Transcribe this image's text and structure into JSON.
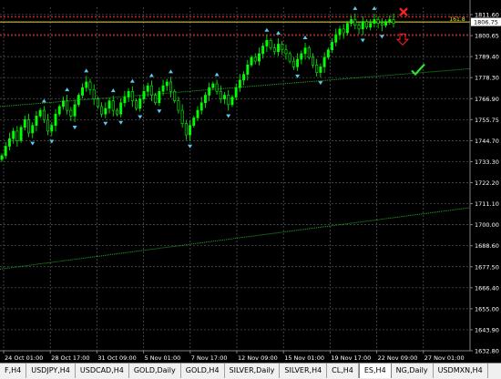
{
  "colors": {
    "background": "#000000",
    "grid": "#5a5a5a",
    "axis_text": "#ffffff",
    "bull": "#00ff00",
    "bear": "#00aa00",
    "wick": "#00ff00",
    "arrow": "#5cc8f0",
    "fib_line": "#e8e020",
    "resistance_line": "#ff2020",
    "trend_line": "#22aa22",
    "cross": "#ff2020",
    "down_arrow": "#ff2020",
    "check": "#30e030",
    "price_tag_bg": "#ffffff",
    "price_tag_text": "#000000"
  },
  "chart_data": {
    "type": "candlestick",
    "symbol": "ES,H4",
    "ylim": [
      1632.8,
      1814.5
    ],
    "price_ticks": [
      "1811.60",
      "1800.65",
      "1789.40",
      "1778.30",
      "1766.90",
      "1755.75",
      "1744.70",
      "1733.30",
      "1722.20",
      "1711.10",
      "1700.00",
      "1688.60",
      "1677.50",
      "1666.40",
      "1655.00",
      "1643.90",
      "1632.80"
    ],
    "time_labels": [
      "24 Oct 01:00",
      "28 Oct 17:00",
      "31 Oct 09:00",
      "5 Nov 01:00",
      "7 Nov 17:00",
      "12 Nov 09:00",
      "15 Nov 01:00",
      "19 Nov 17:00",
      "22 Nov 09:00",
      "27 Nov 01:00"
    ],
    "current_price_label": "1806.75",
    "fib_label": "161.8",
    "fib_level": 1806.75,
    "resistance_levels": [
      1809.5,
      1800.0
    ],
    "trend_lines": [
      {
        "x0": 0,
        "y0": 1762.0,
        "x1": 175,
        "y1": 1782.0
      },
      {
        "x0": 0,
        "y0": 1676.0,
        "x1": 175,
        "y1": 1708.5
      }
    ],
    "signals": {
      "cross_price": 1812.0,
      "down_arrow_price": 1797.5,
      "check_price": 1781.0
    },
    "candles_close": [
      1736,
      1741,
      1745,
      1749,
      1744,
      1751,
      1755,
      1748,
      1752,
      1757,
      1760,
      1755,
      1749,
      1752,
      1758,
      1762,
      1765,
      1760,
      1757,
      1763,
      1768,
      1772,
      1775,
      1771,
      1766,
      1762,
      1758,
      1761,
      1765,
      1760,
      1758,
      1764,
      1767,
      1770,
      1765,
      1761,
      1766,
      1770,
      1773,
      1768,
      1764,
      1770,
      1773,
      1775,
      1770,
      1765,
      1760,
      1753,
      1747,
      1752,
      1756,
      1760,
      1764,
      1768,
      1772,
      1774,
      1770,
      1766,
      1768,
      1763,
      1767,
      1772,
      1776,
      1779,
      1784,
      1788,
      1786,
      1790,
      1794,
      1797,
      1793,
      1791,
      1795,
      1792,
      1790,
      1786,
      1783,
      1787,
      1790,
      1793,
      1788,
      1784,
      1780,
      1783,
      1788,
      1792,
      1796,
      1800,
      1803,
      1801,
      1806,
      1808,
      1805,
      1803,
      1807,
      1804,
      1806,
      1808,
      1806,
      1805,
      1807,
      1808,
      1806
    ]
  },
  "tabs": [
    {
      "label": "F,H4",
      "active": false
    },
    {
      "label": "USDJPY,H4",
      "active": false
    },
    {
      "label": "USDCAD,H4",
      "active": false
    },
    {
      "label": "GOLD,Daily",
      "active": false
    },
    {
      "label": "GOLD,H4",
      "active": false
    },
    {
      "label": "SILVER,Daily",
      "active": false
    },
    {
      "label": "SILVER,H4",
      "active": false
    },
    {
      "label": "CL,H4",
      "active": false
    },
    {
      "label": "ES,H4",
      "active": true
    },
    {
      "label": "NG,Daily",
      "active": false
    },
    {
      "label": "USDMXN,H4",
      "active": false
    }
  ]
}
